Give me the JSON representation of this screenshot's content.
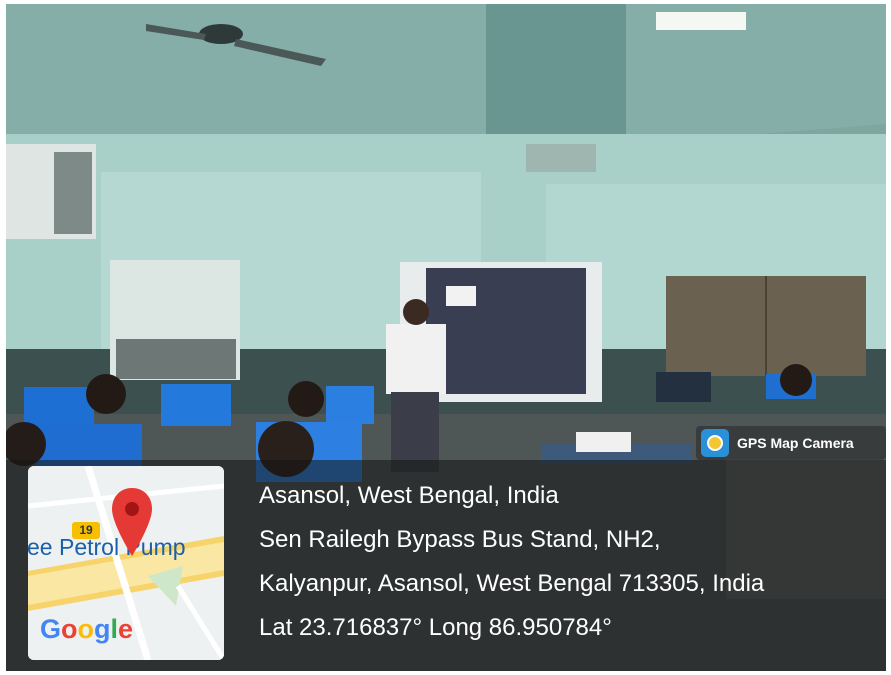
{
  "badge": {
    "icon": "gps-camera-icon",
    "label": "GPS Map Camera"
  },
  "location": {
    "line1": "Asansol, West Bengal, India",
    "line2": "Sen Railegh Bypass Bus Stand, NH2,",
    "line3": "Kalyanpur, Asansol, West Bengal 713305, India",
    "line4": "Lat 23.716837° Long 86.950784°"
  },
  "map": {
    "road_label": "ee Petrol Pump",
    "road_number": "19",
    "brand": "Google",
    "pin_icon": "map-pin-icon"
  },
  "colors": {
    "pin": "#e53935",
    "overlay": "#141414"
  }
}
